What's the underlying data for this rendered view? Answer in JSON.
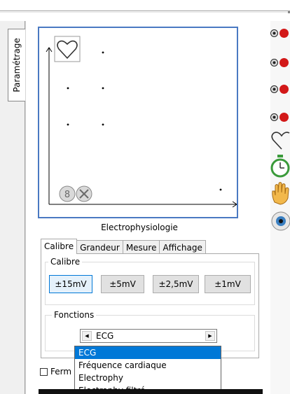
{
  "sidebar": {
    "tab_label": "Paramétrage"
  },
  "plot": {
    "title": "Electrophysiologie"
  },
  "tabs": [
    {
      "label": "Calibre",
      "active": true
    },
    {
      "label": "Grandeur",
      "active": false
    },
    {
      "label": "Mesure",
      "active": false
    },
    {
      "label": "Affichage",
      "active": false
    }
  ],
  "calibre": {
    "group_label": "Calibre",
    "buttons": [
      "±15mV",
      "±5mV",
      "±2,5mV",
      "±1mV"
    ],
    "selected": "±15mV"
  },
  "fonctions": {
    "group_label": "Fonctions",
    "combo_value": "ECG",
    "options": [
      "ECG",
      "Fréquence cardiaque",
      "Electrophy",
      "Electrophy filtré"
    ],
    "highlighted": "ECG"
  },
  "checkbox": {
    "label_partial": "Ferm",
    "checked": false
  },
  "right_icons": [
    "record-red-icon",
    "record-red-icon",
    "record-red-icon",
    "record-red-icon",
    "heart-icon",
    "stopwatch-icon",
    "hand-icon",
    "eye-icon"
  ],
  "colors": {
    "accent": "#0078d7",
    "plot_border": "#4a79c2",
    "record_red": "#d21818"
  }
}
